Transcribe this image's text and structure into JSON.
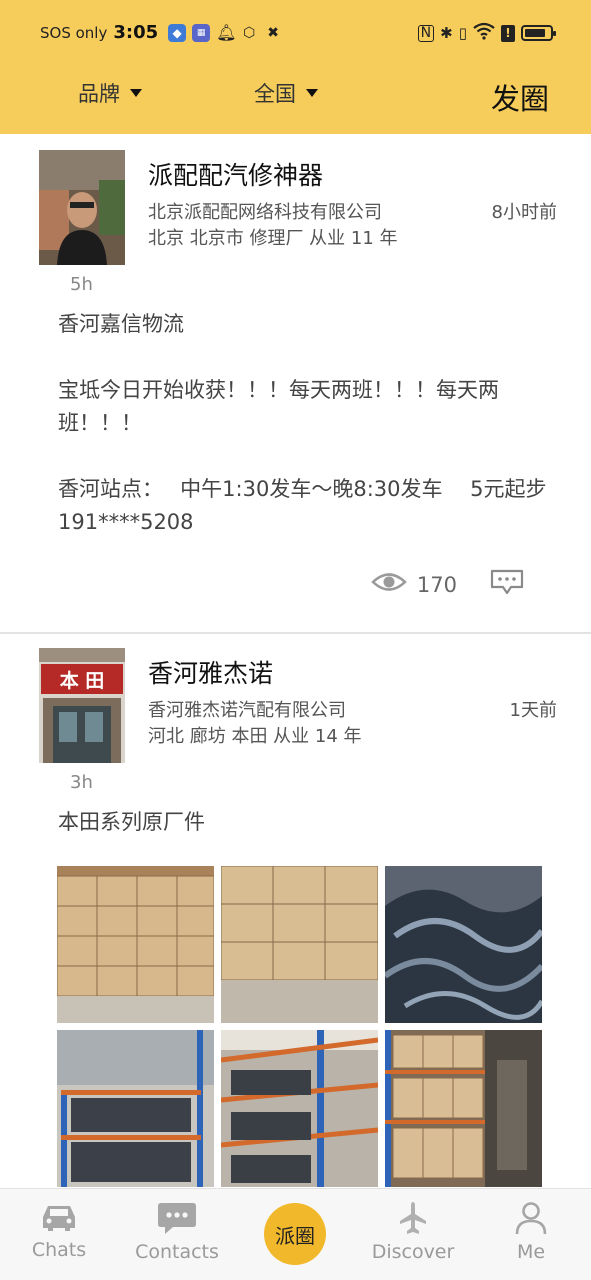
{
  "status_bar": {
    "carrier": "SOS only",
    "time": "3:05",
    "battery_level": 0.85
  },
  "header": {
    "filters": [
      {
        "label": "品牌"
      },
      {
        "label": "全国"
      }
    ],
    "post_label": "发圈"
  },
  "posts": [
    {
      "name": "派配配汽修神器",
      "company": "北京派配配网络科技有限公司",
      "time": "8小时前",
      "location": "北京 北京市 修理厂 从业 11 年",
      "age": "5h",
      "content": [
        "香河嘉信物流",
        "",
        "宝坻今日开始收获！！！每天两班！！！每天两班！！！",
        "",
        "香河站点：　 中午1:30发车～晚8:30发车　 5元起步191****5208"
      ],
      "views": "170"
    },
    {
      "name": "香河雅杰诺",
      "company": "香河雅杰诺汽配有限公司",
      "time": "1天前",
      "location": "河北 廊坊 本田 从业 14 年",
      "age": "3h",
      "content": [
        "本田系列原厂件"
      ],
      "avatar_sign": "本 田"
    }
  ],
  "bottom_nav": {
    "items": [
      {
        "label": "Chats",
        "icon": "car-icon"
      },
      {
        "label": "Contacts",
        "icon": "chat-bubble-icon"
      },
      {
        "label": "Discover",
        "icon": "airplane-icon"
      },
      {
        "label": "Me",
        "icon": "person-icon"
      }
    ],
    "center_label": "派圈"
  },
  "colors": {
    "header_bg": "#f6cd5b",
    "center_button": "#f2b82c",
    "nav_inactive": "#9a9a9a"
  }
}
